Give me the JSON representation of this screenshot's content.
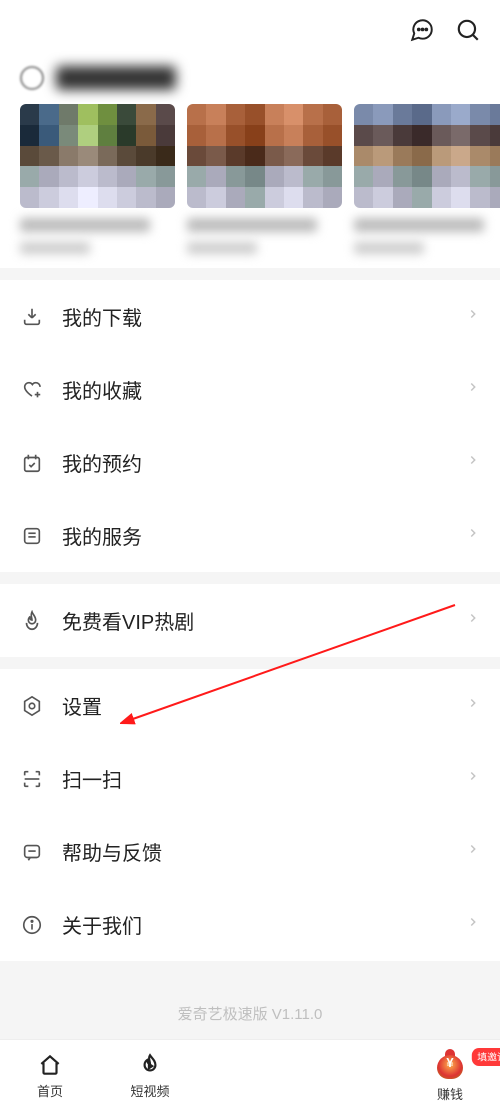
{
  "menu": {
    "downloads": "我的下载",
    "favorites": "我的收藏",
    "reservations": "我的预约",
    "services": "我的服务",
    "free_vip": "免费看VIP热剧",
    "settings": "设置",
    "scan": "扫一扫",
    "help": "帮助与反馈",
    "about": "关于我们"
  },
  "version": "爱奇艺极速版 V1.11.0",
  "tabs": {
    "home": "首页",
    "short_video": "短视频",
    "earn": "赚钱",
    "earn_badge": "填邀请码"
  }
}
